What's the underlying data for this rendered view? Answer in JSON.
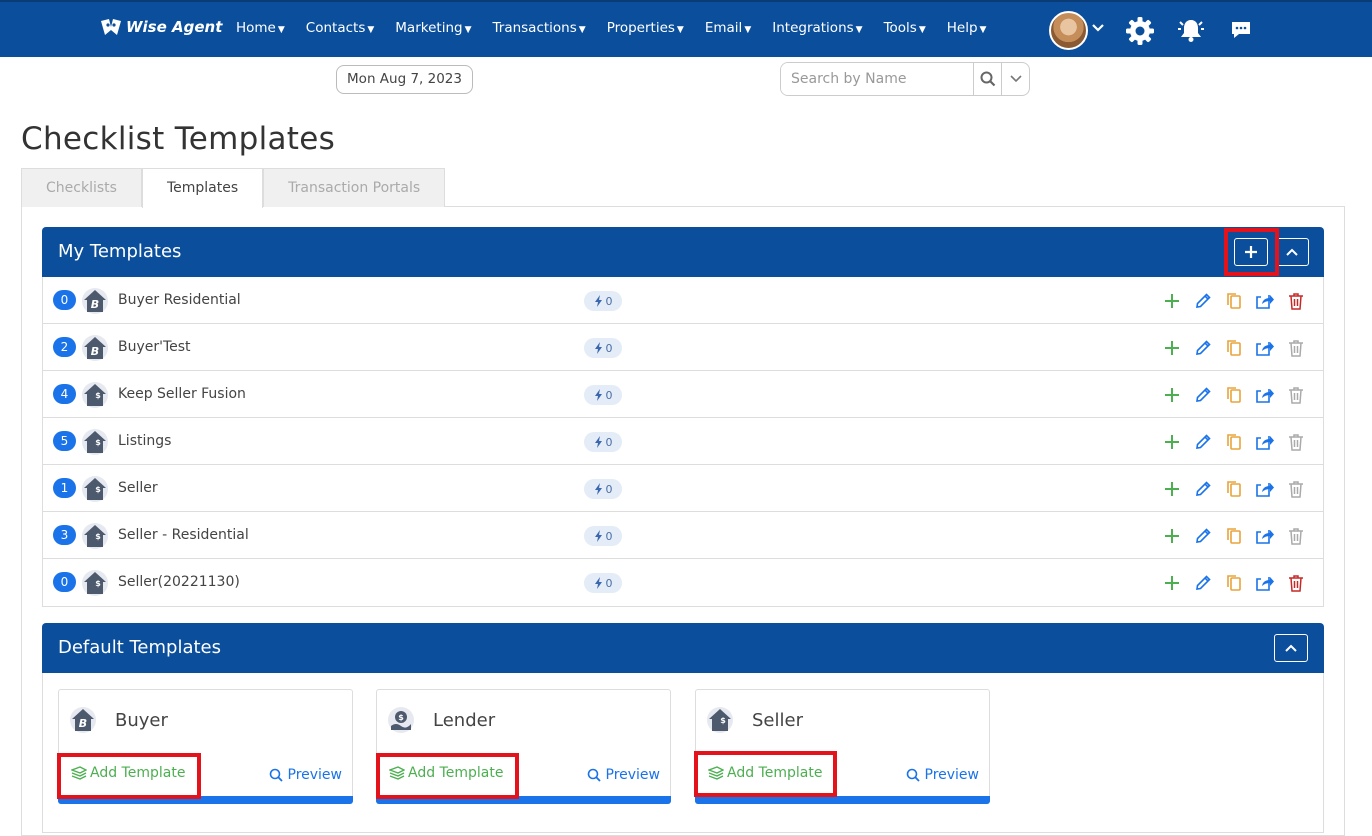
{
  "app": {
    "logo_text": "Wise Agent"
  },
  "nav": [
    {
      "label": "Home"
    },
    {
      "label": "Contacts"
    },
    {
      "label": "Marketing"
    },
    {
      "label": "Transactions"
    },
    {
      "label": "Properties"
    },
    {
      "label": "Email"
    },
    {
      "label": "Integrations"
    },
    {
      "label": "Tools"
    },
    {
      "label": "Help"
    }
  ],
  "toolbar": {
    "date": "Mon Aug 7, 2023",
    "search_placeholder": "Search by Name"
  },
  "page": {
    "title": "Checklist Templates",
    "tabs": [
      {
        "label": "Checklists",
        "active": false
      },
      {
        "label": "Templates",
        "active": true
      },
      {
        "label": "Transaction Portals",
        "active": false
      }
    ]
  },
  "my_templates": {
    "title": "My Templates",
    "rows": [
      {
        "count": "0",
        "icon": "buyer-icon",
        "name": "Buyer Residential",
        "automations": "0",
        "delete_active": true
      },
      {
        "count": "2",
        "icon": "buyer-icon",
        "name": "Buyer'Test",
        "automations": "0",
        "delete_active": false
      },
      {
        "count": "4",
        "icon": "seller-house-icon",
        "name": "Keep Seller Fusion",
        "automations": "0",
        "delete_active": false
      },
      {
        "count": "5",
        "icon": "seller-house-icon",
        "name": "Listings",
        "automations": "0",
        "delete_active": false
      },
      {
        "count": "1",
        "icon": "seller-house-icon",
        "name": "Seller",
        "automations": "0",
        "delete_active": false
      },
      {
        "count": "3",
        "icon": "seller-house-icon",
        "name": "Seller - Residential",
        "automations": "0",
        "delete_active": false
      },
      {
        "count": "0",
        "icon": "seller-house-icon",
        "name": "Seller(20221130)",
        "automations": "0",
        "delete_active": true
      }
    ]
  },
  "default_templates": {
    "title": "Default Templates",
    "cards": [
      {
        "title": "Buyer",
        "icon": "buyer-icon",
        "add_label": "Add Template",
        "preview_label": "Preview"
      },
      {
        "title": "Lender",
        "icon": "lender-icon",
        "add_label": "Add Template",
        "preview_label": "Preview"
      },
      {
        "title": "Seller",
        "icon": "seller-house-icon",
        "add_label": "Add Template",
        "preview_label": "Preview"
      }
    ]
  },
  "colors": {
    "header_blue": "#0b4f9c",
    "badge_blue": "#1a73e8",
    "add_green": "#4caf50",
    "copy_orange": "#e8a33c",
    "delete_red": "#c62828",
    "highlight_red": "#e3121b"
  }
}
